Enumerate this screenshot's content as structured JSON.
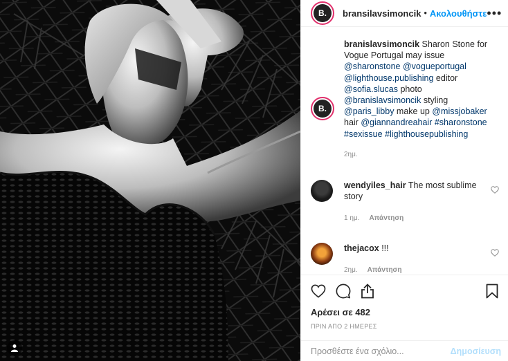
{
  "post": {
    "author": "bransilavsimoncik",
    "follow_label": "Ακολουθήστε",
    "more_label": "•••",
    "avatar_letter": "B.",
    "dot": "•"
  },
  "caption": {
    "username": "branislavsimoncik",
    "parts": [
      {
        "text": " Sharon Stone for Vogue Portugal may issue ",
        "tag": false
      },
      {
        "text": "@sharonstone",
        "tag": true
      },
      {
        "text": " ",
        "tag": false
      },
      {
        "text": "@vogueportugal",
        "tag": true
      },
      {
        "text": " ",
        "tag": false
      },
      {
        "text": "@lighthouse.publishing",
        "tag": true
      },
      {
        "text": " editor ",
        "tag": false
      },
      {
        "text": "@sofia.slucas",
        "tag": true
      },
      {
        "text": " photo ",
        "tag": false
      },
      {
        "text": "@branislavsimoncik",
        "tag": true
      },
      {
        "text": " styling ",
        "tag": false
      },
      {
        "text": "@paris_libby",
        "tag": true
      },
      {
        "text": " make up ",
        "tag": false
      },
      {
        "text": "@missjobaker",
        "tag": true
      },
      {
        "text": " hair ",
        "tag": false
      },
      {
        "text": "@giannandreahair",
        "tag": true
      },
      {
        "text": " ",
        "tag": false
      },
      {
        "text": "#sharonstone",
        "tag": true
      },
      {
        "text": " ",
        "tag": false
      },
      {
        "text": "#sexissue",
        "tag": true
      },
      {
        "text": " ",
        "tag": false
      },
      {
        "text": "#lighthousepublishing",
        "tag": true
      }
    ],
    "age": "2ημ."
  },
  "comments": [
    {
      "username": "wendyiles_hair",
      "text": " The most sublime story",
      "age": "1 ημ.",
      "reply_label": "Απάντηση",
      "avatar": "w"
    },
    {
      "username": "thejacox",
      "text": " !!!",
      "age": "2ημ.",
      "reply_label": "Απάντηση",
      "avatar": "j"
    }
  ],
  "likes_text": "Αρέσει σε 482",
  "timestamp": "ΠΡΙΝ ΑΠΟ 2 ΗΜΕΡΕΣ",
  "add_comment": {
    "placeholder": "Προσθέστε ένα σχόλιο...",
    "post_label": "Δημοσίευση"
  },
  "colors": {
    "link": "#00376b",
    "follow": "#0095f6",
    "muted": "#8e8e8e",
    "post_disabled": "#b2dffc",
    "story_ring": "#e1306c"
  },
  "icons": [
    "user-tag-icon",
    "more-options-icon",
    "heart-icon",
    "comment-icon",
    "share-icon",
    "bookmark-icon"
  ]
}
